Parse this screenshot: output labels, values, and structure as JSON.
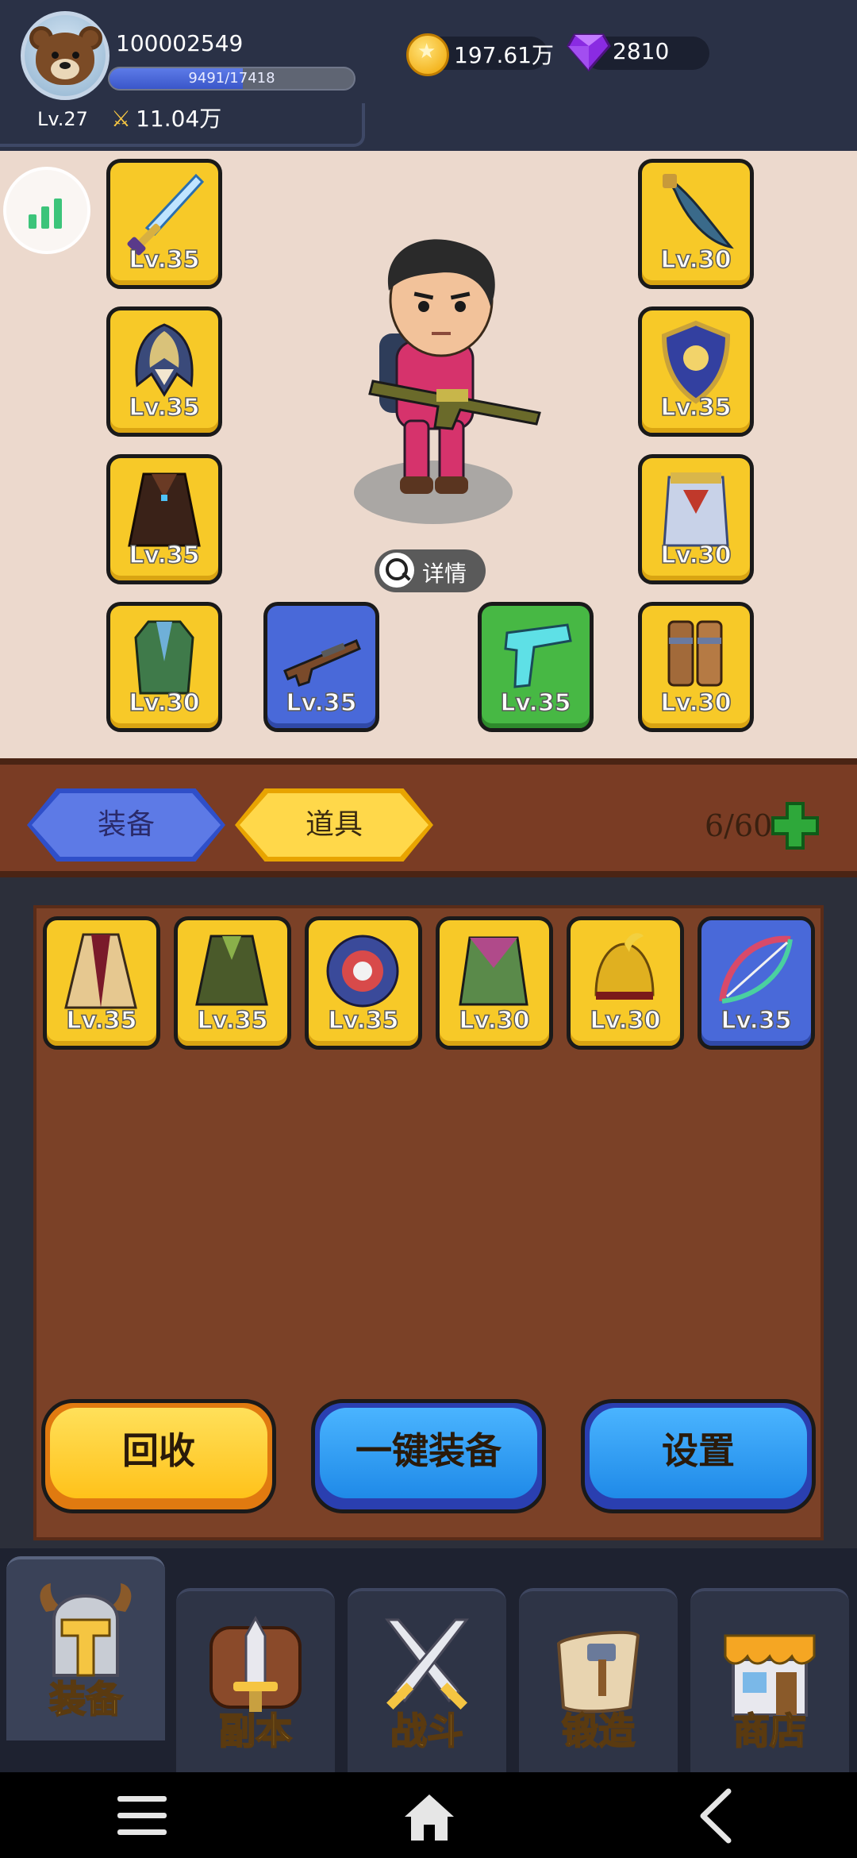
{
  "player": {
    "id": "100002549",
    "level": "Lv.27",
    "xp_text": "9491/17418",
    "xp_fraction": 0.545,
    "power": "11.04万"
  },
  "currency": {
    "coins": "197.61万",
    "gems": "2810"
  },
  "character": {
    "detail_label": "详情",
    "left_slots": [
      {
        "icon": "sword-icon",
        "level": "Lv.35",
        "rarity": "yellow"
      },
      {
        "icon": "helmet-icon",
        "level": "Lv.35",
        "rarity": "yellow"
      },
      {
        "icon": "cloak-icon",
        "level": "Lv.35",
        "rarity": "yellow"
      },
      {
        "icon": "coat-icon",
        "level": "Lv.30",
        "rarity": "yellow"
      }
    ],
    "right_slots": [
      {
        "icon": "scimitar-icon",
        "level": "Lv.30",
        "rarity": "yellow"
      },
      {
        "icon": "shield-icon",
        "level": "Lv.35",
        "rarity": "yellow"
      },
      {
        "icon": "armor-icon",
        "level": "Lv.30",
        "rarity": "yellow"
      },
      {
        "icon": "boots-icon",
        "level": "Lv.30",
        "rarity": "yellow"
      }
    ],
    "weapon_slots": [
      {
        "icon": "rifle-icon",
        "level": "Lv.35",
        "rarity": "blue"
      },
      {
        "icon": "pistol-icon",
        "level": "Lv.35",
        "rarity": "green"
      }
    ]
  },
  "tabs": {
    "equipment": "装备",
    "items": "道具",
    "capacity": "6/60"
  },
  "inventory": [
    {
      "icon": "robe-icon",
      "level": "Lv.35",
      "rarity": "yellow"
    },
    {
      "icon": "jacket-icon",
      "level": "Lv.35",
      "rarity": "yellow"
    },
    {
      "icon": "crest-shield-icon",
      "level": "Lv.35",
      "rarity": "yellow"
    },
    {
      "icon": "vest-icon",
      "level": "Lv.30",
      "rarity": "yellow"
    },
    {
      "icon": "golden-helmet-icon",
      "level": "Lv.30",
      "rarity": "yellow"
    },
    {
      "icon": "crossbow-icon",
      "level": "Lv.35",
      "rarity": "blue"
    }
  ],
  "actions": {
    "recycle": "回收",
    "auto_equip": "一键装备",
    "settings": "设置"
  },
  "nav": {
    "equipment": "装备",
    "dungeon": "副本",
    "battle": "战斗",
    "forge": "锻造",
    "shop": "商店"
  },
  "colors": {
    "accent_yellow": "#f7c928",
    "rarity_blue": "#4969d9",
    "rarity_green": "#47b844",
    "panel_brown": "#7b4127"
  }
}
